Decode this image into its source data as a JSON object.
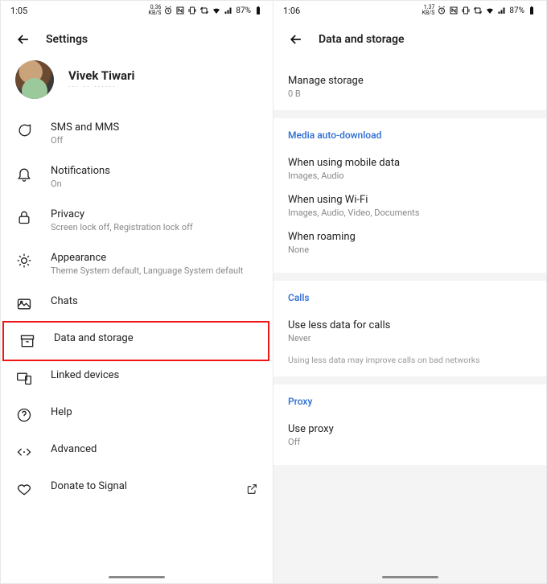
{
  "left": {
    "status": {
      "time": "1:05",
      "net": "0.36",
      "unit": "KB/S",
      "battery": "87%"
    },
    "header": {
      "title": "Settings"
    },
    "profile": {
      "name": "Vivek Tiwari",
      "sub": "··· ·· ······"
    },
    "items": [
      {
        "icon": "chat",
        "title": "SMS and MMS",
        "sub": "Off"
      },
      {
        "icon": "bell",
        "title": "Notifications",
        "sub": "On"
      },
      {
        "icon": "lock",
        "title": "Privacy",
        "sub": "Screen lock off, Registration lock off"
      },
      {
        "icon": "sun",
        "title": "Appearance",
        "sub": "Theme System default, Language System default"
      },
      {
        "icon": "image",
        "title": "Chats",
        "sub": ""
      },
      {
        "icon": "archive",
        "title": "Data and storage",
        "sub": ""
      },
      {
        "icon": "devices",
        "title": "Linked devices",
        "sub": ""
      },
      {
        "icon": "help",
        "title": "Help",
        "sub": ""
      },
      {
        "icon": "code",
        "title": "Advanced",
        "sub": ""
      },
      {
        "icon": "heart",
        "title": "Donate to Signal",
        "sub": ""
      }
    ]
  },
  "right": {
    "status": {
      "time": "1:06",
      "net": "1.37",
      "unit": "KB/S",
      "battery": "87%"
    },
    "header": {
      "title": "Data and storage"
    },
    "storage": {
      "title": "Manage storage",
      "sub": "0 B"
    },
    "media": {
      "header": "Media auto-download",
      "items": [
        {
          "title": "When using mobile data",
          "sub": "Images, Audio"
        },
        {
          "title": "When using Wi-Fi",
          "sub": "Images, Audio, Video, Documents"
        },
        {
          "title": "When roaming",
          "sub": "None"
        }
      ]
    },
    "calls": {
      "header": "Calls",
      "item": {
        "title": "Use less data for calls",
        "sub": "Never"
      },
      "hint": "Using less data may improve calls on bad networks"
    },
    "proxy": {
      "header": "Proxy",
      "item": {
        "title": "Use proxy",
        "sub": "Off"
      }
    }
  }
}
